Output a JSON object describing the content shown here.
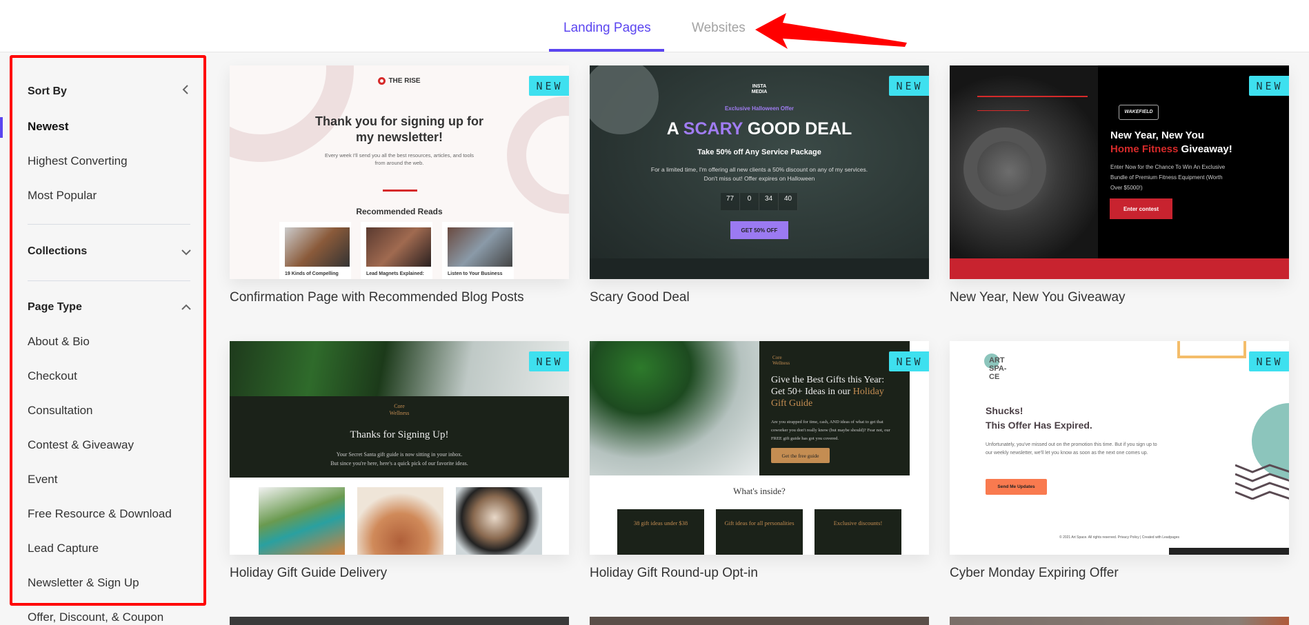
{
  "header": {
    "tabs": [
      {
        "label": "Landing Pages",
        "active": true
      },
      {
        "label": "Websites",
        "active": false
      }
    ],
    "accent_color": "#5b45f0"
  },
  "annotation": {
    "type": "arrow",
    "color": "#ff0000",
    "points_to": "Websites"
  },
  "sidebar": {
    "sort_by": {
      "heading": "Sort By",
      "toggle_icon": "chevron-left-icon",
      "options": [
        "Newest",
        "Highest Converting",
        "Most Popular"
      ],
      "selected": "Newest"
    },
    "collections": {
      "heading": "Collections",
      "toggle_icon": "chevron-down-icon"
    },
    "page_type": {
      "heading": "Page Type",
      "toggle_icon": "chevron-up-icon",
      "items": [
        "About & Bio",
        "Checkout",
        "Consultation",
        "Contest & Giveaway",
        "Event",
        "Free Resource & Download",
        "Lead Capture",
        "Newsletter & Sign Up",
        "Offer, Discount, & Coupon"
      ]
    }
  },
  "badge_label": "NEW",
  "templates": [
    {
      "title": "Confirmation Page with Recommended Blog Posts",
      "preview": {
        "brand": "THE RISE",
        "headline_line1": "Thank you for signing up for",
        "headline_line2": "my newsletter!",
        "sub_line1": "Every week I'll send you all the best resources, articles, and tools",
        "sub_line2": "from around the web.",
        "section": "Recommended Reads",
        "posts": [
          "19 Kinds of Compelling",
          "Lead Magnets Explained:",
          "Listen to Your Business"
        ]
      }
    },
    {
      "title": "Scary Good Deal",
      "preview": {
        "brand_line1": "INSTA",
        "brand_line2": "MEDIA",
        "pre": "Exclusive Halloween Offer",
        "headline_a": "A ",
        "headline_hl": "SCARY",
        "headline_b": " GOOD DEAL",
        "subhead": "Take 50% off Any Service Package",
        "sub_line1": "For a limited time, I'm offering all new clients a 50% discount on any of my services.",
        "sub_line2": "Don't miss out! Offer expires on Halloween",
        "countdown": [
          "77",
          "0",
          "34",
          "40"
        ],
        "button": "GET 50% OFF"
      }
    },
    {
      "title": "New Year, New You Giveaway",
      "preview": {
        "brand": "WAKEFIELD",
        "headline_line1": "New Year, New You",
        "headline_hl": "Home Fitness",
        "headline_b": " Giveaway!",
        "sub": "Enter Now for the Chance To Win An Exclusive Bundle of Premium Fitness Equipment (Worth Over $5000!)",
        "button": "Enter contest"
      }
    },
    {
      "title": "Holiday Gift Guide Delivery",
      "preview": {
        "brand_line1": "Core",
        "brand_line2": "Wellness",
        "headline": "Thanks for Signing Up!",
        "sub_line1": "Your Secret Santa gift guide is now sitting in your inbox.",
        "sub_line2": "But since you're here, here's a quick pick of our favorite ideas."
      }
    },
    {
      "title": "Holiday Gift Round-up Opt-in",
      "preview": {
        "brand_line1": "Core",
        "brand_line2": "Wellness",
        "headline_a": "Give the Best Gifts this Year: Get 50+ Ideas in our ",
        "headline_hl": "Holiday Gift Guide",
        "sub": "Are you strapped for time, cash, AND ideas of what to get that coworker you don't really know (but maybe should)? Fear not, our FREE gift guide has got you covered.",
        "button": "Get the free guide",
        "section": "What's inside?",
        "boxes": [
          "38 gift ideas under $38",
          "Gift ideas for all personalities",
          "Exclusive discounts!"
        ]
      }
    },
    {
      "title": "Cyber Monday Expiring Offer",
      "preview": {
        "brand": "ART SPA- CE",
        "headline_line1": "Shucks!",
        "headline_line2": "This Offer Has Expired.",
        "sub": "Unfortunately, you've missed out on the promotion this time. But if you sign up to our weekly newsletter, we'll let you know as soon as the next one comes up.",
        "button": "Send Me Updates",
        "footer": "© 2021 Art Space. All rights reserved. Privacy Policy | Created with Leadpages"
      }
    }
  ]
}
